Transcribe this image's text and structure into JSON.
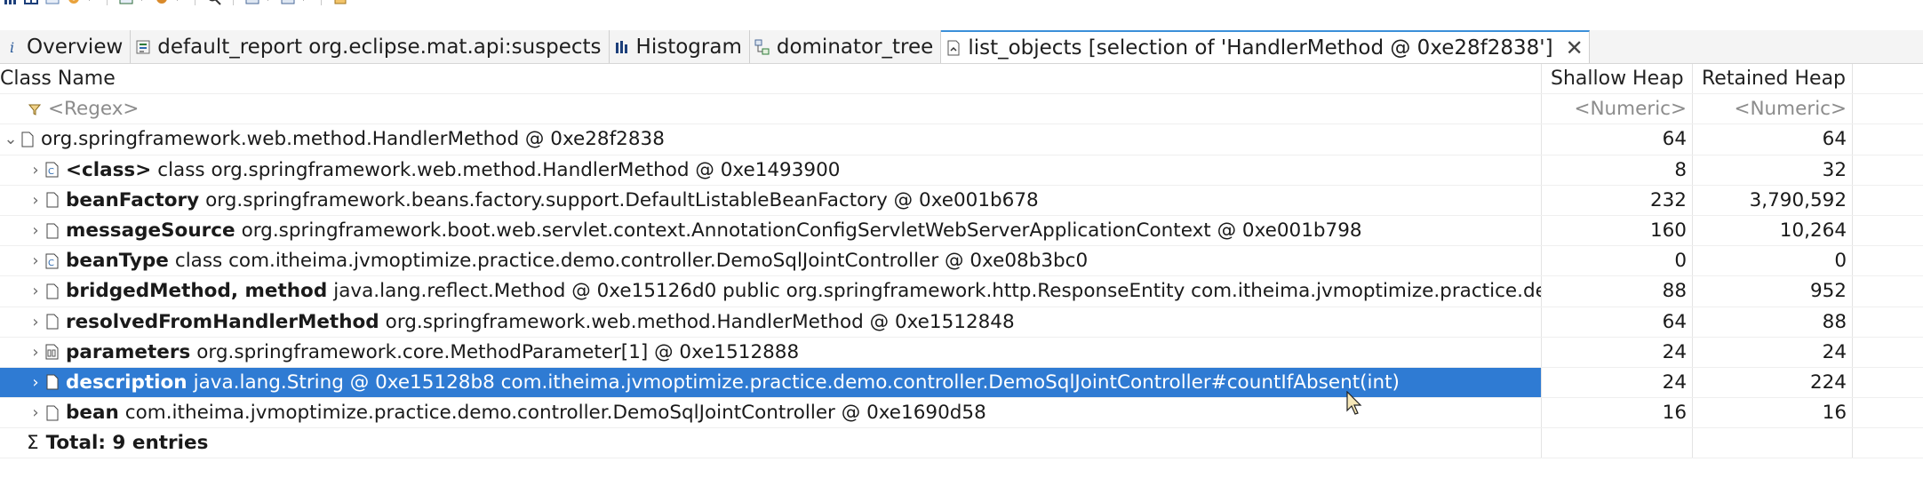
{
  "toolbar": {
    "icons": [
      "bar-chart-icon",
      "table-icon",
      "query-icon",
      "gear-icon",
      "report-icon",
      "search-icon",
      "layout-icon",
      "image-icon",
      "export-icon"
    ]
  },
  "tabs": [
    {
      "label": "Overview",
      "icon": "info-icon"
    },
    {
      "label": "default_report  org.eclipse.mat.api:suspects",
      "icon": "report-icon"
    },
    {
      "label": "Histogram",
      "icon": "histogram-icon"
    },
    {
      "label": "dominator_tree",
      "icon": "tree-icon"
    },
    {
      "label": "list_objects  [selection of 'HandlerMethod @ 0xe28f2838']",
      "icon": "list-icon",
      "active": true
    }
  ],
  "tab_close": "✕",
  "table": {
    "headers": {
      "name": "Class Name",
      "shallow": "Shallow Heap",
      "retained": "Retained Heap"
    },
    "filter": {
      "name": "<Regex>",
      "shallow": "<Numeric>",
      "retained": "<Numeric>"
    },
    "root": {
      "text": "org.springframework.web.method.HandlerMethod @ 0xe28f2838",
      "shallow": "64",
      "retained": "64"
    },
    "rows": [
      {
        "field": "<class>",
        "text": "class org.springframework.web.method.HandlerMethod @ 0xe1493900",
        "shallow": "8",
        "retained": "32",
        "icon": "class-object-icon"
      },
      {
        "field": "beanFactory",
        "text": "org.springframework.beans.factory.support.DefaultListableBeanFactory @ 0xe001b678",
        "shallow": "232",
        "retained": "3,790,592",
        "icon": "object-icon"
      },
      {
        "field": "messageSource",
        "text": "org.springframework.boot.web.servlet.context.AnnotationConfigServletWebServerApplicationContext @ 0xe001b798",
        "shallow": "160",
        "retained": "10,264",
        "icon": "object-icon"
      },
      {
        "field": "beanType",
        "text": "class com.itheima.jvmoptimize.practice.demo.controller.DemoSqlJointController @ 0xe08b3bc0",
        "shallow": "0",
        "retained": "0",
        "icon": "class-object-icon"
      },
      {
        "field": "bridgedMethod, method",
        "text": "java.lang.reflect.Method @ 0xe15126d0  public org.springframework.http.ResponseEntity com.itheima.jvmoptimize.practice.de",
        "shallow": "88",
        "retained": "952",
        "icon": "object-icon"
      },
      {
        "field": "resolvedFromHandlerMethod",
        "text": "org.springframework.web.method.HandlerMethod @ 0xe1512848",
        "shallow": "64",
        "retained": "88",
        "icon": "object-icon"
      },
      {
        "field": "parameters",
        "text": "org.springframework.core.MethodParameter[1] @ 0xe1512888",
        "shallow": "24",
        "retained": "24",
        "icon": "array-icon"
      },
      {
        "field": "description",
        "text": "java.lang.String @ 0xe15128b8  com.itheima.jvmoptimize.practice.demo.controller.DemoSqlJointController#countIfAbsent(int)",
        "shallow": "24",
        "retained": "224",
        "icon": "object-icon",
        "selected": true
      },
      {
        "field": "bean",
        "text": "com.itheima.jvmoptimize.practice.demo.controller.DemoSqlJointController @ 0xe1690d58",
        "shallow": "16",
        "retained": "16",
        "icon": "object-icon"
      }
    ],
    "total": {
      "sigma": "Σ",
      "label": "Total: 9 entries"
    }
  },
  "colors": {
    "selection": "#2f7bd3",
    "tab_accent": "#3b8fd9"
  }
}
